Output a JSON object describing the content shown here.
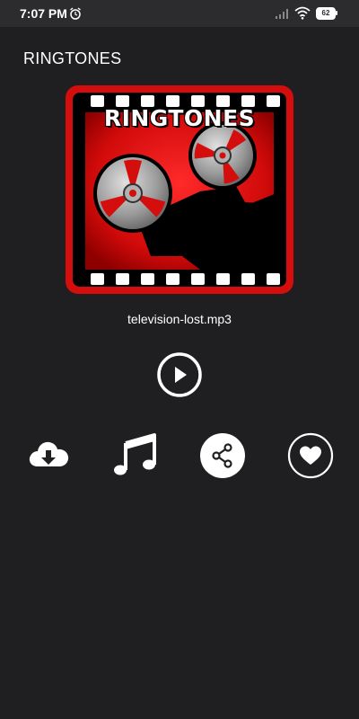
{
  "status_bar": {
    "time": "7:07 PM",
    "battery_level": "62"
  },
  "app": {
    "title": "RINGTONES"
  },
  "artwork": {
    "title": "RINGTONES"
  },
  "track": {
    "file_name": "television-lost.mp3"
  },
  "icons": {
    "play": "play-icon",
    "download": "cloud-download-icon",
    "music": "music-note-icon",
    "share": "share-icon",
    "favorite": "heart-icon"
  },
  "colors": {
    "background": "#1f1f22",
    "status_bar": "#2c2c2f",
    "artwork_red": "#d40d0d",
    "icon": "#ffffff"
  }
}
